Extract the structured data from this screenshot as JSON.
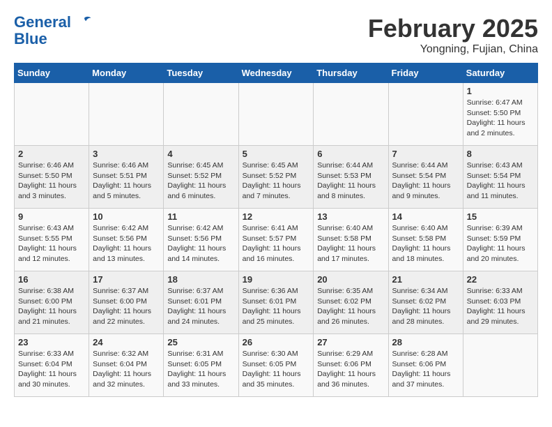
{
  "logo": {
    "line1": "General",
    "line2": "Blue"
  },
  "title": "February 2025",
  "location": "Yongning, Fujian, China",
  "days_of_week": [
    "Sunday",
    "Monday",
    "Tuesday",
    "Wednesday",
    "Thursday",
    "Friday",
    "Saturday"
  ],
  "weeks": [
    [
      {
        "day": "",
        "info": ""
      },
      {
        "day": "",
        "info": ""
      },
      {
        "day": "",
        "info": ""
      },
      {
        "day": "",
        "info": ""
      },
      {
        "day": "",
        "info": ""
      },
      {
        "day": "",
        "info": ""
      },
      {
        "day": "1",
        "info": "Sunrise: 6:47 AM\nSunset: 5:50 PM\nDaylight: 11 hours and 2 minutes."
      }
    ],
    [
      {
        "day": "2",
        "info": "Sunrise: 6:46 AM\nSunset: 5:50 PM\nDaylight: 11 hours and 3 minutes."
      },
      {
        "day": "3",
        "info": "Sunrise: 6:46 AM\nSunset: 5:51 PM\nDaylight: 11 hours and 5 minutes."
      },
      {
        "day": "4",
        "info": "Sunrise: 6:45 AM\nSunset: 5:52 PM\nDaylight: 11 hours and 6 minutes."
      },
      {
        "day": "5",
        "info": "Sunrise: 6:45 AM\nSunset: 5:52 PM\nDaylight: 11 hours and 7 minutes."
      },
      {
        "day": "6",
        "info": "Sunrise: 6:44 AM\nSunset: 5:53 PM\nDaylight: 11 hours and 8 minutes."
      },
      {
        "day": "7",
        "info": "Sunrise: 6:44 AM\nSunset: 5:54 PM\nDaylight: 11 hours and 9 minutes."
      },
      {
        "day": "8",
        "info": "Sunrise: 6:43 AM\nSunset: 5:54 PM\nDaylight: 11 hours and 11 minutes."
      }
    ],
    [
      {
        "day": "9",
        "info": "Sunrise: 6:43 AM\nSunset: 5:55 PM\nDaylight: 11 hours and 12 minutes."
      },
      {
        "day": "10",
        "info": "Sunrise: 6:42 AM\nSunset: 5:56 PM\nDaylight: 11 hours and 13 minutes."
      },
      {
        "day": "11",
        "info": "Sunrise: 6:42 AM\nSunset: 5:56 PM\nDaylight: 11 hours and 14 minutes."
      },
      {
        "day": "12",
        "info": "Sunrise: 6:41 AM\nSunset: 5:57 PM\nDaylight: 11 hours and 16 minutes."
      },
      {
        "day": "13",
        "info": "Sunrise: 6:40 AM\nSunset: 5:58 PM\nDaylight: 11 hours and 17 minutes."
      },
      {
        "day": "14",
        "info": "Sunrise: 6:40 AM\nSunset: 5:58 PM\nDaylight: 11 hours and 18 minutes."
      },
      {
        "day": "15",
        "info": "Sunrise: 6:39 AM\nSunset: 5:59 PM\nDaylight: 11 hours and 20 minutes."
      }
    ],
    [
      {
        "day": "16",
        "info": "Sunrise: 6:38 AM\nSunset: 6:00 PM\nDaylight: 11 hours and 21 minutes."
      },
      {
        "day": "17",
        "info": "Sunrise: 6:37 AM\nSunset: 6:00 PM\nDaylight: 11 hours and 22 minutes."
      },
      {
        "day": "18",
        "info": "Sunrise: 6:37 AM\nSunset: 6:01 PM\nDaylight: 11 hours and 24 minutes."
      },
      {
        "day": "19",
        "info": "Sunrise: 6:36 AM\nSunset: 6:01 PM\nDaylight: 11 hours and 25 minutes."
      },
      {
        "day": "20",
        "info": "Sunrise: 6:35 AM\nSunset: 6:02 PM\nDaylight: 11 hours and 26 minutes."
      },
      {
        "day": "21",
        "info": "Sunrise: 6:34 AM\nSunset: 6:02 PM\nDaylight: 11 hours and 28 minutes."
      },
      {
        "day": "22",
        "info": "Sunrise: 6:33 AM\nSunset: 6:03 PM\nDaylight: 11 hours and 29 minutes."
      }
    ],
    [
      {
        "day": "23",
        "info": "Sunrise: 6:33 AM\nSunset: 6:04 PM\nDaylight: 11 hours and 30 minutes."
      },
      {
        "day": "24",
        "info": "Sunrise: 6:32 AM\nSunset: 6:04 PM\nDaylight: 11 hours and 32 minutes."
      },
      {
        "day": "25",
        "info": "Sunrise: 6:31 AM\nSunset: 6:05 PM\nDaylight: 11 hours and 33 minutes."
      },
      {
        "day": "26",
        "info": "Sunrise: 6:30 AM\nSunset: 6:05 PM\nDaylight: 11 hours and 35 minutes."
      },
      {
        "day": "27",
        "info": "Sunrise: 6:29 AM\nSunset: 6:06 PM\nDaylight: 11 hours and 36 minutes."
      },
      {
        "day": "28",
        "info": "Sunrise: 6:28 AM\nSunset: 6:06 PM\nDaylight: 11 hours and 37 minutes."
      },
      {
        "day": "",
        "info": ""
      }
    ]
  ]
}
